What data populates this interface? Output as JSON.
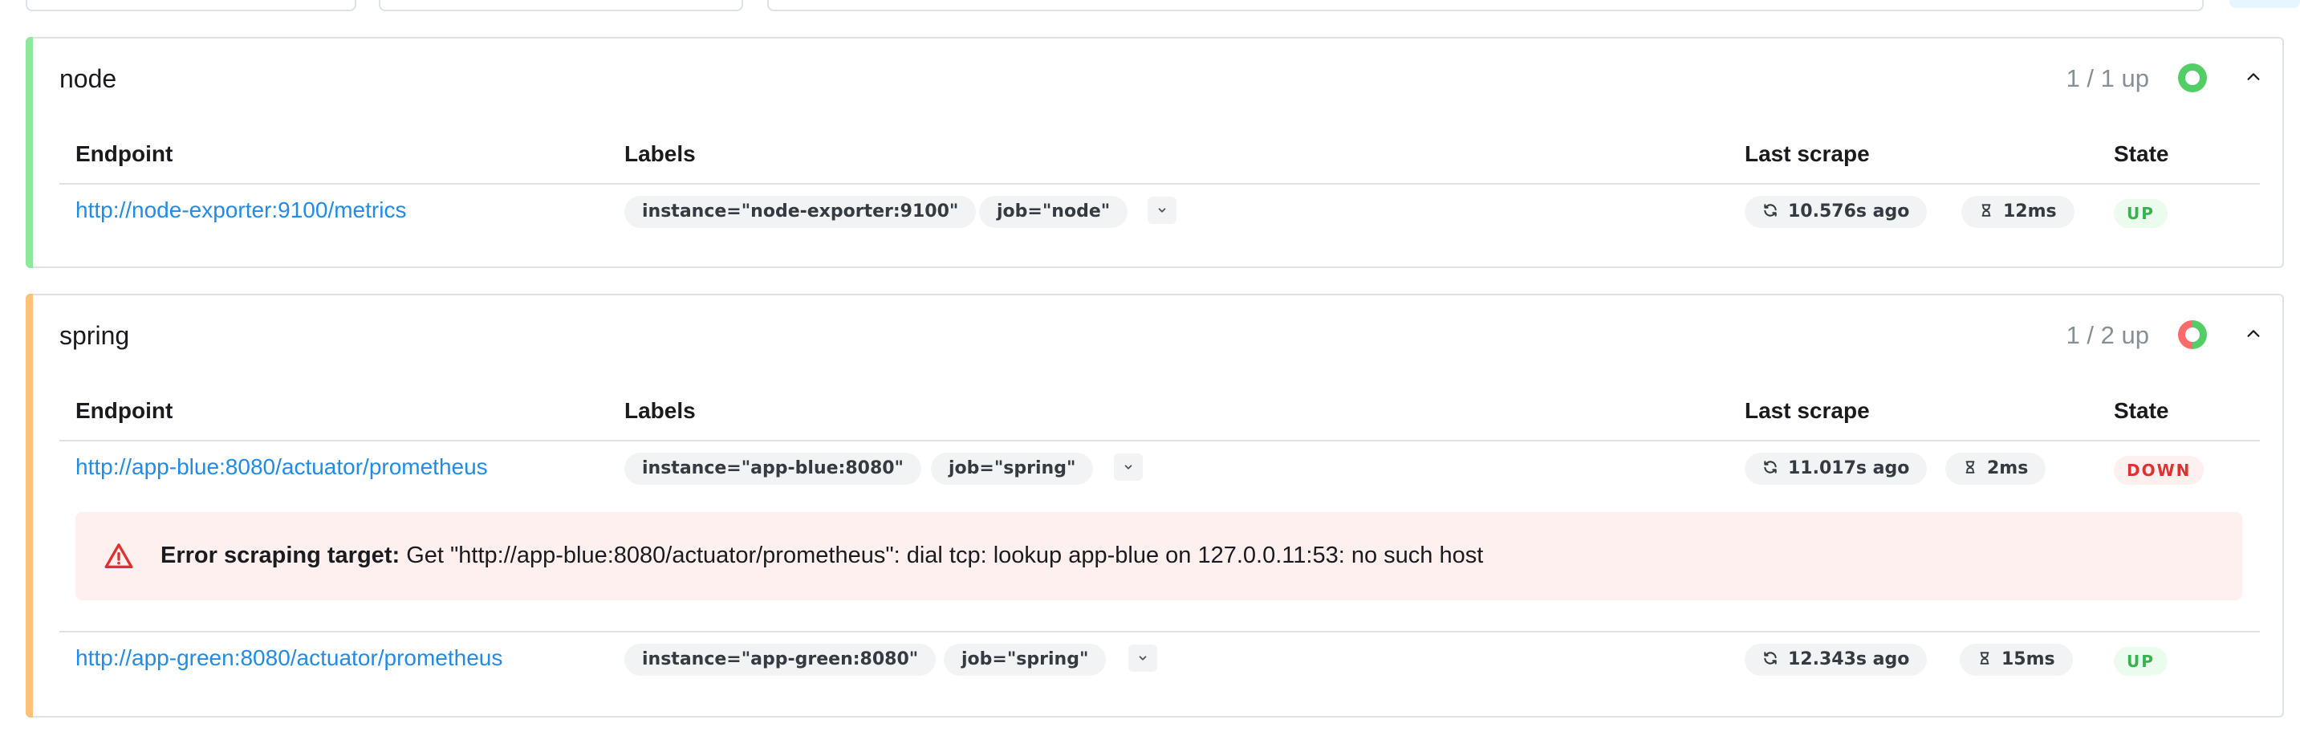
{
  "colors": {
    "up_bar": "#8ce99a",
    "mixed_bar": "#ffc078",
    "up_green": "#51cf66",
    "down_red": "#ff6b6b",
    "link": "#228be6"
  },
  "columns": {
    "endpoint": "Endpoint",
    "labels": "Labels",
    "last_scrape": "Last scrape",
    "state": "State"
  },
  "pools": [
    {
      "name": "node",
      "up_text": "1 / 1 up",
      "health_fraction_up": 1.0,
      "targets": [
        {
          "endpoint": "http://node-exporter:9100/metrics",
          "labels": [
            "instance=\"node-exporter:9100\"",
            "job=\"node\""
          ],
          "last_scrape": "10.576s ago",
          "duration": "12ms",
          "state": "UP"
        }
      ]
    },
    {
      "name": "spring",
      "up_text": "1 / 2 up",
      "health_fraction_up": 0.5,
      "targets": [
        {
          "endpoint": "http://app-blue:8080/actuator/prometheus",
          "labels": [
            "instance=\"app-blue:8080\"",
            "job=\"spring\""
          ],
          "last_scrape": "11.017s ago",
          "duration": "2ms",
          "state": "DOWN",
          "error_title": "Error scraping target:",
          "error_text": "Get \"http://app-blue:8080/actuator/prometheus\": dial tcp: lookup app-blue on 127.0.0.11:53: no such host"
        },
        {
          "endpoint": "http://app-green:8080/actuator/prometheus",
          "labels": [
            "instance=\"app-green:8080\"",
            "job=\"spring\""
          ],
          "last_scrape": "12.343s ago",
          "duration": "15ms",
          "state": "UP"
        }
      ]
    }
  ],
  "icons": {
    "collapse": "chevron-up-icon",
    "expand_labels": "chevron-down-icon",
    "refresh": "refresh-icon",
    "duration": "hourglass-icon",
    "warning": "alert-triangle-icon"
  }
}
